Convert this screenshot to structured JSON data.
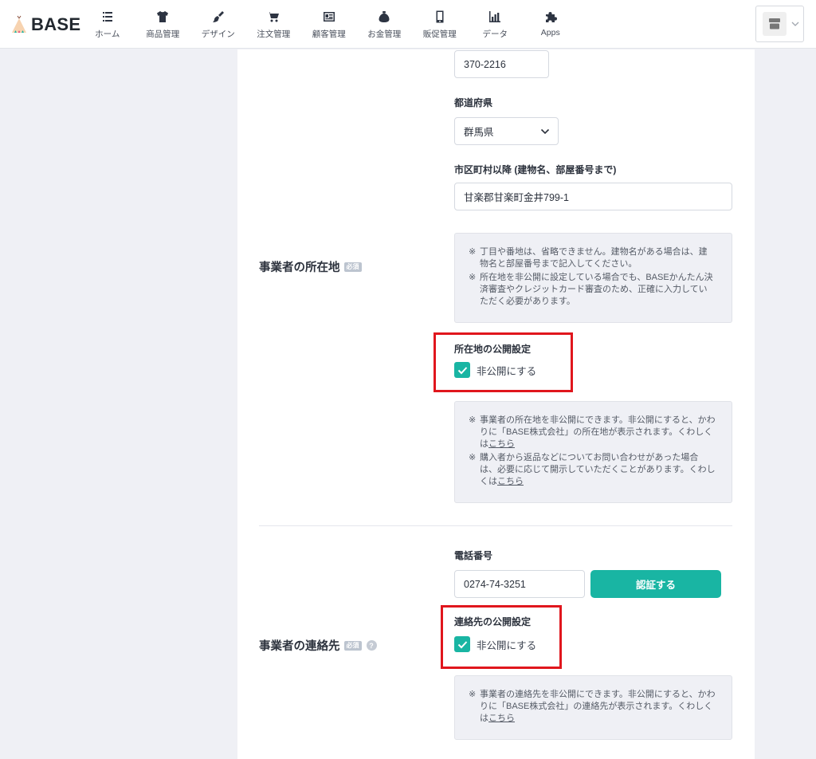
{
  "header": {
    "logo_text": "BASE",
    "nav": [
      {
        "label": "ホーム",
        "icon": "home-list-icon"
      },
      {
        "label": "商品管理",
        "icon": "tshirt-icon"
      },
      {
        "label": "デザイン",
        "icon": "paintbrush-icon"
      },
      {
        "label": "注文管理",
        "icon": "cart-icon"
      },
      {
        "label": "顧客管理",
        "icon": "id-card-icon"
      },
      {
        "label": "お金管理",
        "icon": "money-bag-icon"
      },
      {
        "label": "販促管理",
        "icon": "smartphone-icon"
      },
      {
        "label": "データ",
        "icon": "bar-chart-icon"
      },
      {
        "label": "Apps",
        "icon": "puzzle-icon"
      }
    ],
    "shop_switcher_icon": "shop-icon"
  },
  "address_section": {
    "title": "事業者の所在地",
    "required_badge": "必須",
    "postal_code": {
      "value": "370-2216"
    },
    "prefecture": {
      "label": "都道府県",
      "selected": "群馬県"
    },
    "address": {
      "label": "市区町村以降 (建物名、部屋番号まで)",
      "value": "甘楽郡甘楽町金井799-1"
    },
    "notes": [
      {
        "mark": "※",
        "text": "丁目や番地は、省略できません。建物名がある場合は、建物名と部屋番号まで記入してください。"
      },
      {
        "mark": "※",
        "text": "所在地を非公開に設定している場合でも、BASEかんたん決済審査やクレジットカード審査のため、正確に入力していただく必要があります。"
      }
    ],
    "visibility": {
      "label": "所在地の公開設定",
      "checkbox_label": "非公開にする",
      "checked": true
    },
    "visibility_notes": [
      {
        "mark": "※",
        "text": "事業者の所在地を非公開にできます。非公開にすると、かわりに「BASE株式会社」の所在地が表示されます。くわしくは",
        "link": "こちら"
      },
      {
        "mark": "※",
        "text": "購入者から返品などについてお問い合わせがあった場合は、必要に応じて開示していただくことがあります。くわしくは",
        "link": "こちら"
      }
    ]
  },
  "contact_section": {
    "title": "事業者の連絡先",
    "required_badge": "必須",
    "help_icon": "?",
    "phone": {
      "label": "電話番号",
      "value": "0274-74-3251"
    },
    "verify_button": "認証する",
    "visibility": {
      "label": "連絡先の公開設定",
      "checkbox_label": "非公開にする",
      "checked": true
    },
    "visibility_notes": [
      {
        "mark": "※",
        "text": "事業者の連絡先を非公開にできます。非公開にすると、かわりに「BASE株式会社」の連絡先が表示されます。くわしくは",
        "link": "こちら"
      }
    ]
  },
  "colors": {
    "accent": "#19b5a3",
    "highlight": "#e0161d",
    "page_bg": "#eff0f5"
  }
}
